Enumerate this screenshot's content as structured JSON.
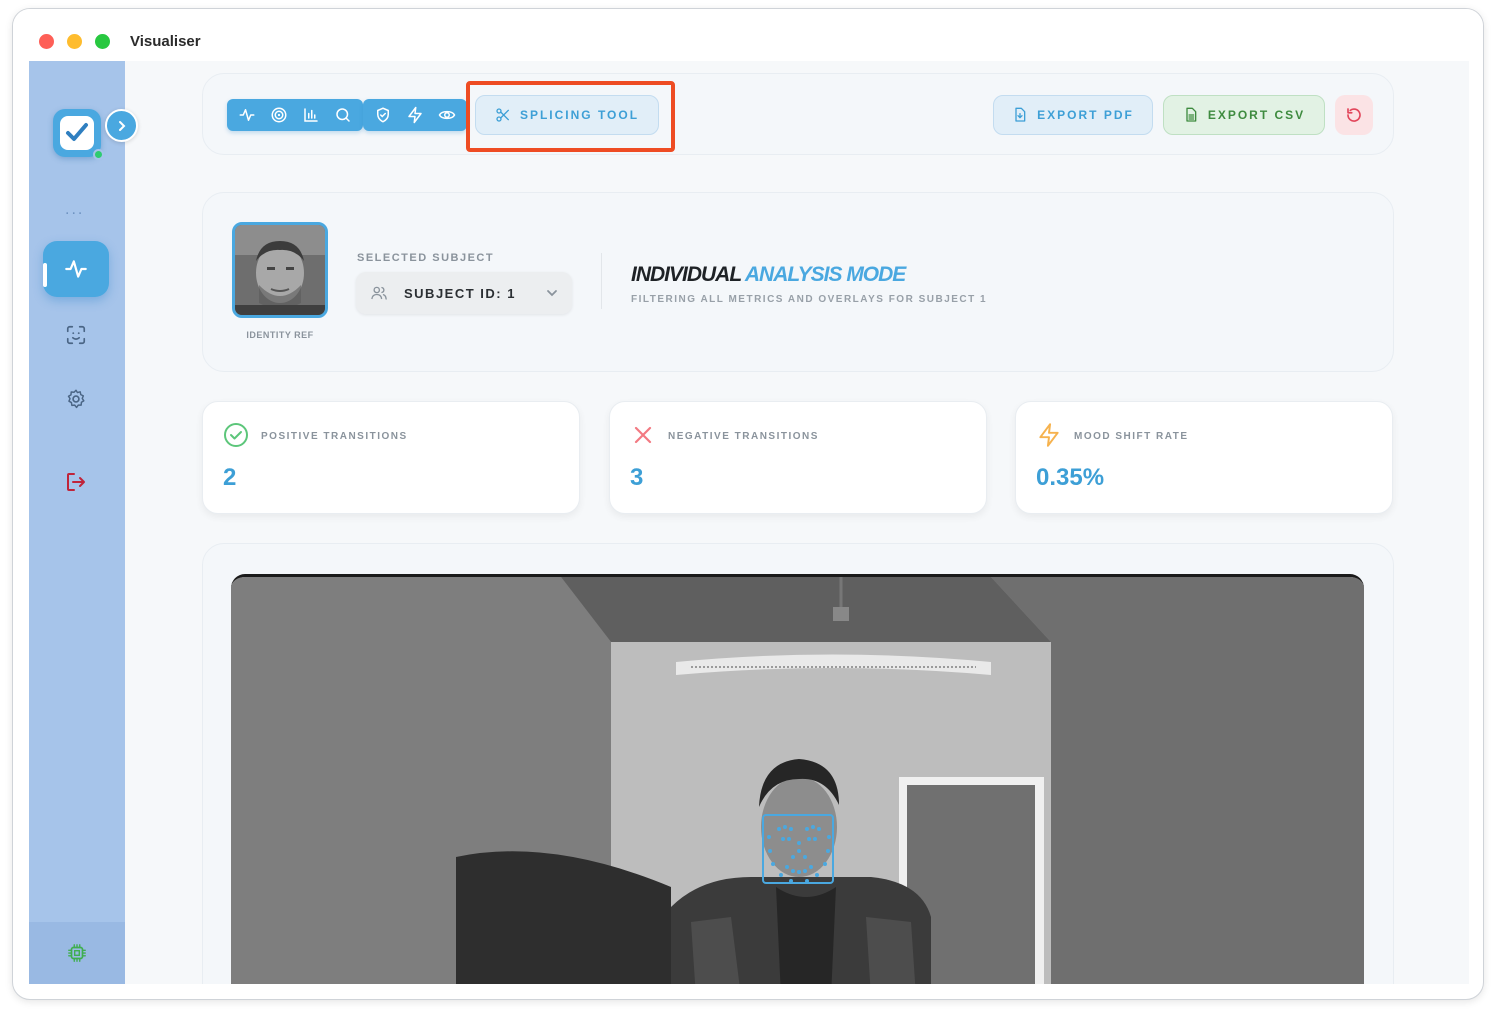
{
  "window": {
    "title": "Visualiser"
  },
  "sidebar": {
    "more": "...",
    "items": [
      {
        "name": "activity",
        "icon": "activity-icon",
        "active": true
      },
      {
        "name": "face-scan",
        "icon": "face-scan-icon",
        "active": false
      },
      {
        "name": "settings",
        "icon": "gear-icon",
        "active": false
      },
      {
        "name": "logout",
        "icon": "logout-icon",
        "active": false
      }
    ],
    "footer_icon": "cpu-chip-icon"
  },
  "toolbar": {
    "tool_group_1": [
      "activity-icon",
      "target-icon",
      "bar-chart-icon",
      "search-icon"
    ],
    "tool_group_2": [
      "shield-check-icon",
      "lightning-icon",
      "eye-icon"
    ],
    "splicing_label": "SPLICING TOOL",
    "export_pdf_label": "EXPORT PDF",
    "export_csv_label": "EXPORT CSV",
    "reset_icon": "reset-icon"
  },
  "subject": {
    "identity_ref_label": "IDENTITY REF",
    "selected_label": "SELECTED SUBJECT",
    "selected_value": "SUBJECT ID: 1",
    "mode_title_part1": "INDIVIDUAL",
    "mode_title_part2": "ANALYSIS MODE",
    "mode_subtitle": "FILTERING ALL METRICS AND OVERLAYS FOR SUBJECT 1"
  },
  "stats": [
    {
      "label": "POSITIVE TRANSITIONS",
      "value": "2",
      "icon": "check-circle-icon",
      "color": "#5cc67a"
    },
    {
      "label": "NEGATIVE TRANSITIONS",
      "value": "3",
      "icon": "x-icon",
      "color": "#f27a82"
    },
    {
      "label": "MOOD SHIFT RATE",
      "value": "0.35%",
      "icon": "lightning-icon",
      "color": "#f6b24e"
    }
  ],
  "colors": {
    "accent": "#4aa8e0",
    "sidebar": "#a6c4ea",
    "highlight": "#ee4c23"
  }
}
